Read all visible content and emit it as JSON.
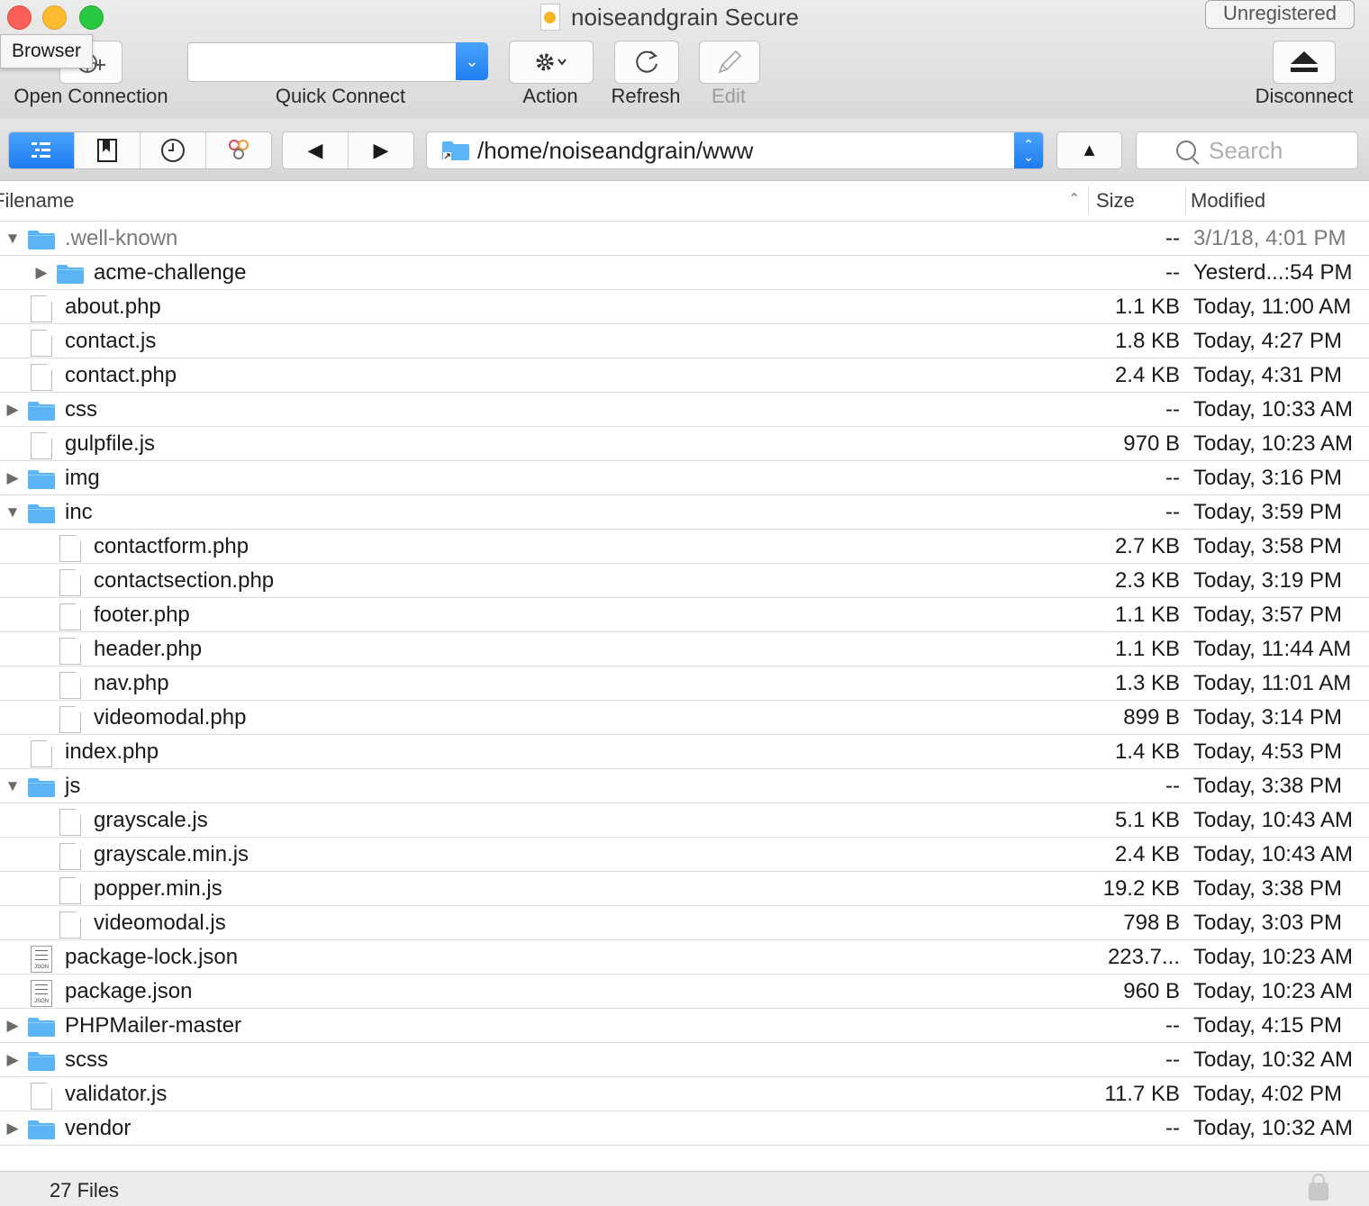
{
  "window": {
    "title": "noiseandgrain Secure",
    "badge": "Unregistered",
    "tooltip": "Browser"
  },
  "toolbar": {
    "open_connection": "Open Connection",
    "quick_connect": "Quick Connect",
    "quick_connect_value": "",
    "action": "Action",
    "refresh": "Refresh",
    "edit": "Edit",
    "disconnect": "Disconnect"
  },
  "navbar": {
    "path": "/home/noiseandgrain/www",
    "search_placeholder": "Search",
    "view_modes": [
      "browser-view-icon",
      "bookmarks-icon",
      "history-icon",
      "bonjour-icon"
    ],
    "active_view": "browser-view-icon"
  },
  "columns": {
    "filename": "Filename",
    "size": "Size",
    "modified": "Modified"
  },
  "files": [
    {
      "name": ".well-known",
      "type": "folder",
      "level": 0,
      "expanded": true,
      "size": "--",
      "modified": "3/1/18, 4:01 PM",
      "hidden": true
    },
    {
      "name": "acme-challenge",
      "type": "folder",
      "level": 1,
      "expanded": false,
      "size": "--",
      "modified": "Yesterd...:54 PM"
    },
    {
      "name": "about.php",
      "type": "file",
      "level": 0,
      "size": "1.1 KB",
      "modified": "Today, 11:00 AM"
    },
    {
      "name": "contact.js",
      "type": "file",
      "level": 0,
      "size": "1.8 KB",
      "modified": "Today, 4:27 PM"
    },
    {
      "name": "contact.php",
      "type": "file",
      "level": 0,
      "size": "2.4 KB",
      "modified": "Today, 4:31 PM"
    },
    {
      "name": "css",
      "type": "folder",
      "level": 0,
      "expanded": false,
      "size": "--",
      "modified": "Today, 10:33 AM"
    },
    {
      "name": "gulpfile.js",
      "type": "file",
      "level": 0,
      "size": "970 B",
      "modified": "Today, 10:23 AM"
    },
    {
      "name": "img",
      "type": "folder",
      "level": 0,
      "expanded": false,
      "size": "--",
      "modified": "Today, 3:16 PM"
    },
    {
      "name": "inc",
      "type": "folder",
      "level": 0,
      "expanded": true,
      "size": "--",
      "modified": "Today, 3:59 PM"
    },
    {
      "name": "contactform.php",
      "type": "file",
      "level": 1,
      "size": "2.7 KB",
      "modified": "Today, 3:58 PM"
    },
    {
      "name": "contactsection.php",
      "type": "file",
      "level": 1,
      "size": "2.3 KB",
      "modified": "Today, 3:19 PM"
    },
    {
      "name": "footer.php",
      "type": "file",
      "level": 1,
      "size": "1.1 KB",
      "modified": "Today, 3:57 PM"
    },
    {
      "name": "header.php",
      "type": "file",
      "level": 1,
      "size": "1.1 KB",
      "modified": "Today, 11:44 AM"
    },
    {
      "name": "nav.php",
      "type": "file",
      "level": 1,
      "size": "1.3 KB",
      "modified": "Today, 11:01 AM"
    },
    {
      "name": "videomodal.php",
      "type": "file",
      "level": 1,
      "size": "899 B",
      "modified": "Today, 3:14 PM"
    },
    {
      "name": "index.php",
      "type": "file",
      "level": 0,
      "size": "1.4 KB",
      "modified": "Today, 4:53 PM"
    },
    {
      "name": "js",
      "type": "folder",
      "level": 0,
      "expanded": true,
      "size": "--",
      "modified": "Today, 3:38 PM"
    },
    {
      "name": "grayscale.js",
      "type": "file",
      "level": 1,
      "size": "5.1 KB",
      "modified": "Today, 10:43 AM"
    },
    {
      "name": "grayscale.min.js",
      "type": "file",
      "level": 1,
      "size": "2.4 KB",
      "modified": "Today, 10:43 AM"
    },
    {
      "name": "popper.min.js",
      "type": "file",
      "level": 1,
      "size": "19.2 KB",
      "modified": "Today, 3:38 PM"
    },
    {
      "name": "videomodal.js",
      "type": "file",
      "level": 1,
      "size": "798 B",
      "modified": "Today, 3:03 PM"
    },
    {
      "name": "package-lock.json",
      "type": "json",
      "level": 0,
      "size": "223.7...",
      "modified": "Today, 10:23 AM"
    },
    {
      "name": "package.json",
      "type": "json",
      "level": 0,
      "size": "960 B",
      "modified": "Today, 10:23 AM"
    },
    {
      "name": "PHPMailer-master",
      "type": "folder",
      "level": 0,
      "expanded": false,
      "size": "--",
      "modified": "Today, 4:15 PM"
    },
    {
      "name": "scss",
      "type": "folder",
      "level": 0,
      "expanded": false,
      "size": "--",
      "modified": "Today, 10:32 AM"
    },
    {
      "name": "validator.js",
      "type": "file",
      "level": 0,
      "size": "11.7 KB",
      "modified": "Today, 4:02 PM"
    },
    {
      "name": "vendor",
      "type": "folder",
      "level": 0,
      "expanded": false,
      "size": "--",
      "modified": "Today, 10:32 AM"
    }
  ],
  "status": {
    "text": "27 Files"
  },
  "colors": {
    "accent": "#1d7cee",
    "folder": "#5ab4f5",
    "close": "#fc5f57",
    "minimize": "#fdbc2e",
    "maximize": "#28c840"
  }
}
